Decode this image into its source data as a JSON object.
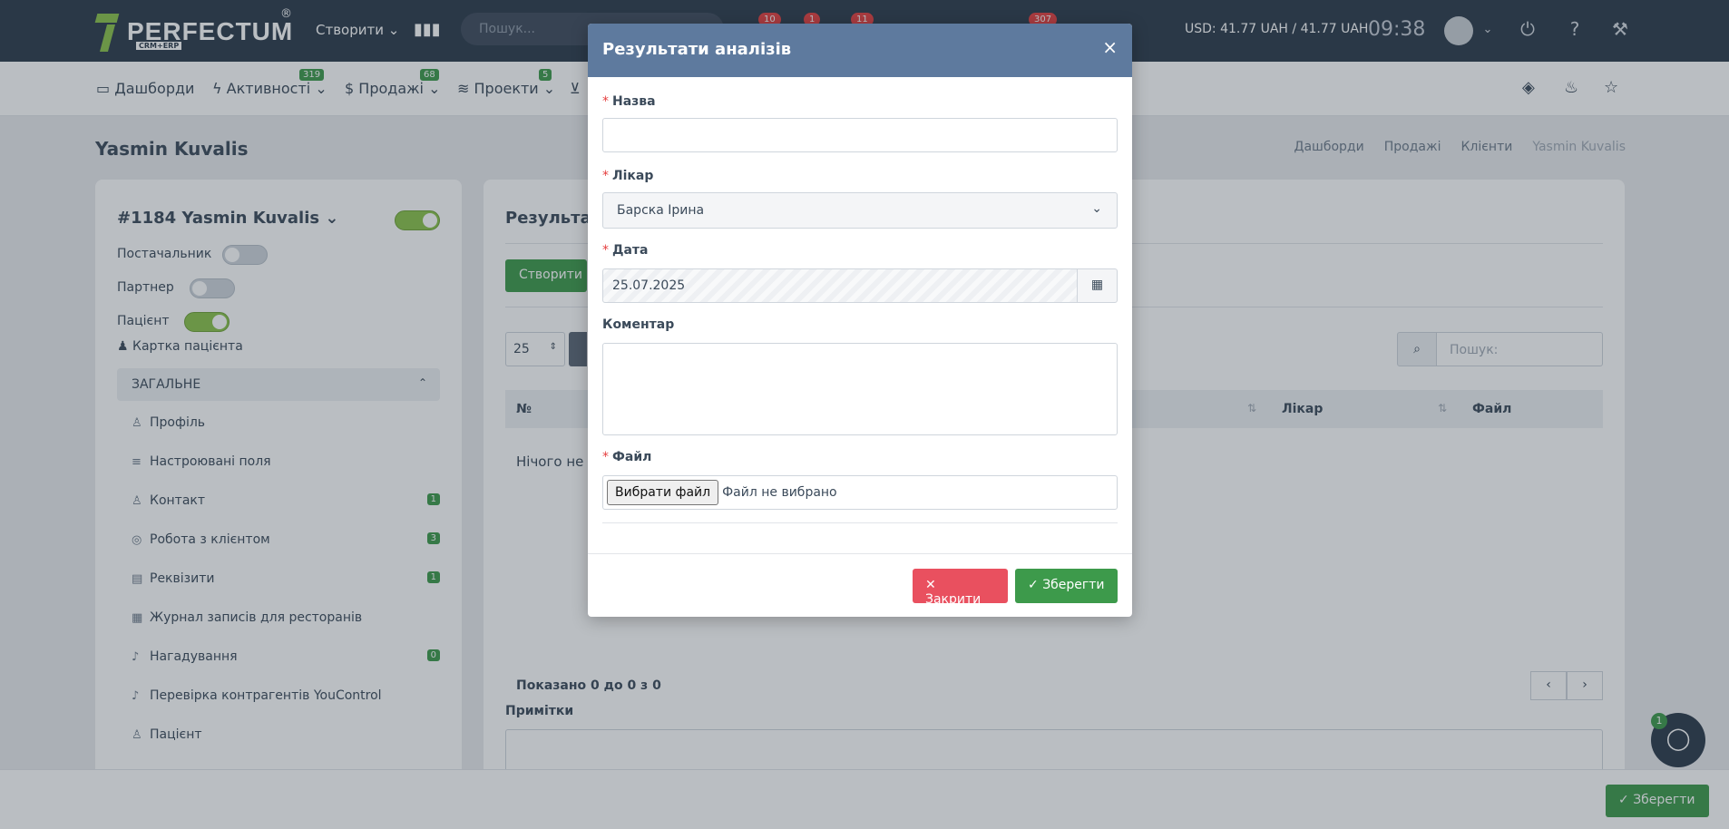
{
  "topbar": {
    "brand": "PERFECTUM",
    "brand_sub": "CRM+ERP",
    "brand_reg": "®",
    "create_label": "Створити",
    "search_placeholder": "Пошук...",
    "badges": [
      "10",
      "1",
      "11",
      "307"
    ],
    "currency": "USD: 41.77 UAH / 41.77 UAH",
    "time": "09:38"
  },
  "nav": {
    "items": [
      {
        "label": "Дашборди",
        "badge": ""
      },
      {
        "label": "Активності",
        "badge": "319"
      },
      {
        "label": "Продажі",
        "badge": "68"
      },
      {
        "label": "Проекти",
        "badge": "5"
      }
    ]
  },
  "page": {
    "title": "Yasmin Kuvalis",
    "breadcrumbs": [
      "Дашборди",
      "Продажі",
      "Клієнти",
      "Yasmin Kuvalis"
    ]
  },
  "left": {
    "client_title": "#1184 Yasmin Kuvalis",
    "supplier_label": "Постачальник",
    "partner_label": "Партнер",
    "patient_label": "Пацієнт",
    "card_link": "Картка пацієнта",
    "section": "ЗАГАЛЬНЕ",
    "items": [
      {
        "label": "Профіль",
        "count": ""
      },
      {
        "label": "Настроювані поля",
        "count": ""
      },
      {
        "label": "Контакт",
        "count": "1"
      },
      {
        "label": "Робота з клієнтом",
        "count": "3"
      },
      {
        "label": "Реквізити",
        "count": "1"
      },
      {
        "label": "Журнал записів для ресторанів",
        "count": ""
      },
      {
        "label": "Нагадування",
        "count": "0"
      },
      {
        "label": "Перевірка контрагентів YouControl",
        "count": ""
      },
      {
        "label": "Пацієнт",
        "count": ""
      }
    ]
  },
  "right": {
    "title": "Результати аналізів",
    "create_label": "Створити запис",
    "page_size": "25",
    "search_placeholder": "Пошук:",
    "columns": [
      "№",
      "Лікар",
      "Файл"
    ],
    "empty_text": "Нічого не знайдено",
    "shown_text": "Показано 0 до 0 з 0",
    "notes_label": "Примітки"
  },
  "bottom": {
    "save_label": "Зберегти"
  },
  "chat": {
    "badge": "1"
  },
  "modal": {
    "title": "Результати аналізів",
    "name_label": "Назва",
    "name_value": "",
    "doctor_label": "Лікар",
    "doctor_value": "Барска Ірина",
    "date_label": "Дата",
    "date_value": "25.07.2025",
    "comment_label": "Коментар",
    "file_label": "Файл",
    "file_button": "Вибрати файл",
    "file_status": "Файл не вибрано",
    "close_label": "Закрити",
    "save_label": "Зберегти"
  }
}
